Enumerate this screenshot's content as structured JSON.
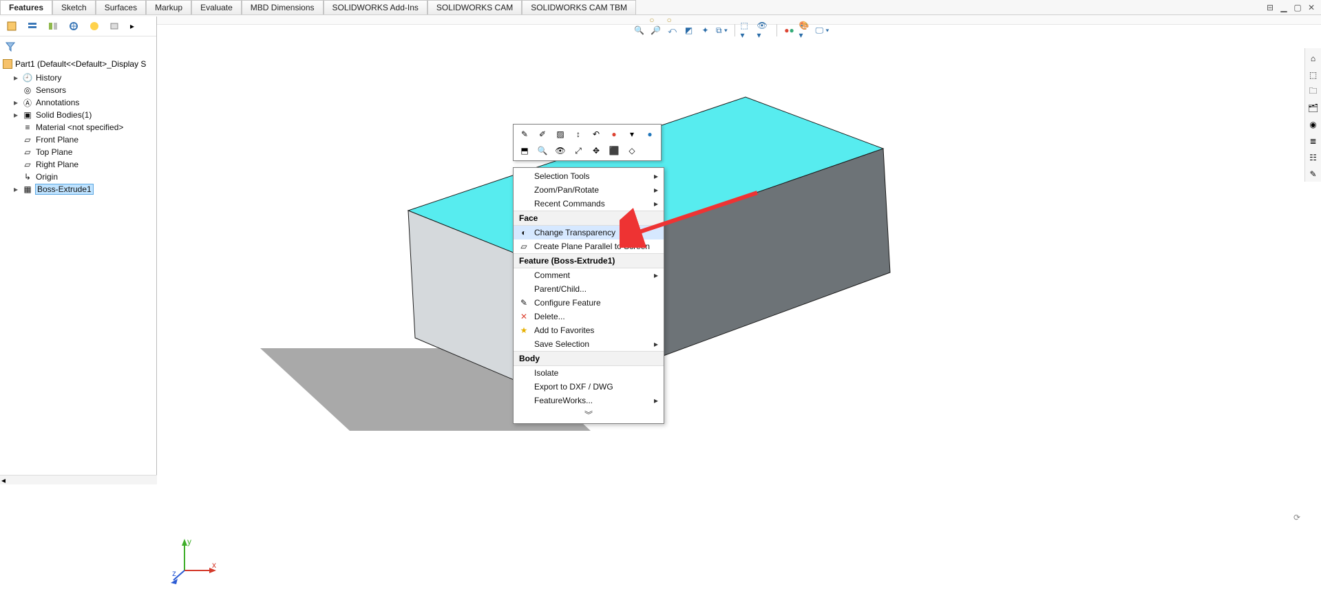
{
  "tabs": {
    "items": [
      "Features",
      "Sketch",
      "Surfaces",
      "Markup",
      "Evaluate",
      "MBD Dimensions",
      "SOLIDWORKS Add-Ins",
      "SOLIDWORKS CAM",
      "SOLIDWORKS CAM TBM"
    ],
    "active": "Features"
  },
  "feature_tree": {
    "root": "Part1  (Default<<Default>_Display S",
    "items": [
      {
        "label": "History",
        "icon": "history-icon",
        "caret": "▸"
      },
      {
        "label": "Sensors",
        "icon": "sensors-icon",
        "caret": ""
      },
      {
        "label": "Annotations",
        "icon": "annotations-icon",
        "caret": "▸"
      },
      {
        "label": "Solid Bodies(1)",
        "icon": "solid-bodies-icon",
        "caret": "▸"
      },
      {
        "label": "Material <not specified>",
        "icon": "material-icon",
        "caret": ""
      },
      {
        "label": "Front Plane",
        "icon": "plane-icon",
        "caret": ""
      },
      {
        "label": "Top Plane",
        "icon": "plane-icon",
        "caret": ""
      },
      {
        "label": "Right Plane",
        "icon": "plane-icon",
        "caret": ""
      },
      {
        "label": "Origin",
        "icon": "origin-icon",
        "caret": ""
      },
      {
        "label": "Boss-Extrude1",
        "icon": "extrude-icon",
        "caret": "▸",
        "selected": true
      }
    ]
  },
  "context_menu": {
    "top": [
      {
        "label": "Selection Tools",
        "submenu": true
      },
      {
        "label": "Zoom/Pan/Rotate",
        "submenu": true,
        "underline": "R"
      },
      {
        "label": "Recent Commands",
        "submenu": true,
        "underline": "R"
      }
    ],
    "face_header": "Face",
    "face": [
      {
        "label": "Change Transparency",
        "icon": "transparency-icon",
        "underline": "h",
        "highlight": true
      },
      {
        "label": "Create Plane Parallel to Screen",
        "icon": "plane-parallel-icon",
        "underline": "P"
      }
    ],
    "feature_header": "Feature (Boss-Extrude1)",
    "feature": [
      {
        "label": "Comment",
        "submenu": true
      },
      {
        "label": "Parent/Child...",
        "underline": "C"
      },
      {
        "label": "Configure Feature",
        "icon": "configure-icon",
        "underline": "r"
      },
      {
        "label": "Delete...",
        "icon": "delete-icon",
        "underline": "D"
      },
      {
        "label": "Add to Favorites",
        "icon": "favorites-icon"
      },
      {
        "label": "Save Selection",
        "submenu": true
      }
    ],
    "body_header": "Body",
    "body": [
      {
        "label": "Isolate"
      },
      {
        "label": "Export to DXF / DWG"
      },
      {
        "label": "FeatureWorks...",
        "submenu": true,
        "underline": "W"
      }
    ]
  },
  "view_toolbar_icons": [
    "zoom-fit-icon",
    "zoom-area-icon",
    "prev-view-icon",
    "section-icon",
    "dynamic-view-icon",
    "view-orientation-icon",
    "display-style-icon",
    "hide-show-icon",
    "edit-appearance-icon",
    "apply-scene-icon",
    "view-settings-icon"
  ],
  "fm_tabs": [
    "feature-manager-icon",
    "property-manager-icon",
    "configuration-manager-icon",
    "dimxpert-icon",
    "display-manager-icon",
    "cam-manager-icon"
  ],
  "taskpane_icons": [
    "home-icon",
    "resources-icon",
    "design-library-icon",
    "file-explorer-icon",
    "view-palette-icon",
    "appearances-icon",
    "custom-props-icon",
    "forum-icon"
  ],
  "empty_cmd": {
    "dot1": "○",
    "dot2": "○"
  }
}
